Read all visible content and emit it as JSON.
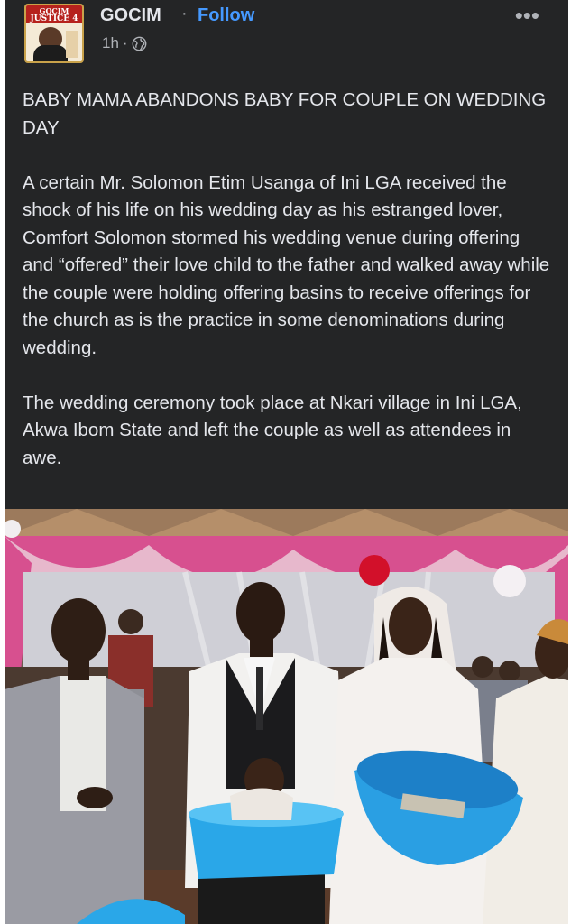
{
  "page": {
    "name": "GOCIM",
    "separator": "·",
    "follow_label": "Follow",
    "time": "1h",
    "time_separator": "·",
    "audience_icon": "globe-icon",
    "more_icon": "more-options-icon",
    "more_label": "•••"
  },
  "avatar": {
    "badge_top": "GOCIM",
    "badge_title": "JUSTICE 4"
  },
  "post": {
    "headline": "BABY MAMA ABANDONS BABY FOR COUPLE ON WEDDING DAY",
    "paragraph_1": "A certain Mr. Solomon Etim Usanga of Ini LGA received the shock of his life on his wedding day as his estranged lover, Comfort Solomon stormed his wedding venue during offering and “offered” their love child to the father and walked away while the couple were holding offering basins to receive offerings for the church as is the practice in some denominations during wedding.",
    "paragraph_2": "The wedding ceremony took place at Nkari village in Ini LGA, Akwa Ibom State and left the couple as well as attendees in awe."
  },
  "photo": {
    "subject": "wedding-photo"
  },
  "colors": {
    "card_bg": "#242526",
    "text": "#e4e6eb",
    "secondary_text": "#b0b3b8",
    "link": "#4599ff",
    "basin_blue": "#2aa7e8"
  }
}
